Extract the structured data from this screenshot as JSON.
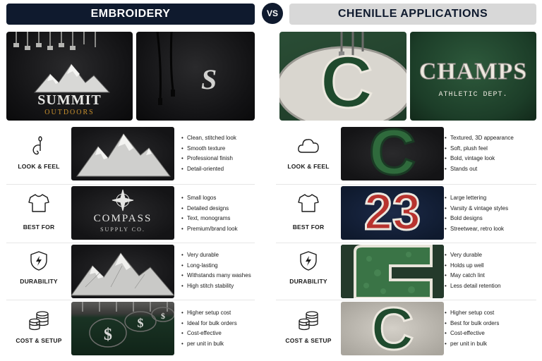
{
  "header": {
    "left_title": "EMBROIDERY",
    "vs": "VS",
    "right_title": "CHENILLE APPLICATIONS"
  },
  "photos": {
    "summit_main": "SUMMIT",
    "summit_sub": "OUTDOORS",
    "hoodie_letter": "S",
    "hoop_letter": "C",
    "champs_main": "CHAMPS",
    "champs_sub": "ATHLETIC DEPT."
  },
  "embroidery": {
    "rows": [
      {
        "label": "LOOK & FEEL",
        "icon": "needle-thread-icon",
        "bullets": [
          "Clean, stitched look",
          "Smooth texture",
          "Professional finish",
          "Detail-oriented"
        ]
      },
      {
        "label": "BEST FOR",
        "icon": "tshirt-icon",
        "compass_main": "COMPASS",
        "compass_sub": "SUPPLY CO.",
        "bullets": [
          "Small logos",
          "Detailed designs",
          "Text, monograms",
          "Premium/brand look"
        ]
      },
      {
        "label": "DURABILITY",
        "icon": "shield-bolt-icon",
        "bullets": [
          "Very durable",
          "Long-lasting",
          "Withstands many washes",
          "High stitch stability"
        ]
      },
      {
        "label": "COST & SETUP",
        "icon": "coin-stack-icon",
        "bullets": [
          "Higher setup cost",
          "Ideal for bulk orders",
          "Cost-effective",
          "per unit in bulk"
        ]
      }
    ]
  },
  "chenille": {
    "rows": [
      {
        "label": "LOOK & FEEL",
        "icon": "cloud-icon",
        "letter": "C",
        "bullets": [
          "Textured, 3D appearance",
          "Soft, plush feel",
          "Bold, vintage look",
          "Stands out"
        ]
      },
      {
        "label": "BEST FOR",
        "icon": "tshirt-icon",
        "number": "23",
        "bullets": [
          "Large lettering",
          "Varsity & vintage styles",
          "Bold designs",
          "Streetwear, retro look"
        ]
      },
      {
        "label": "DURABILITY",
        "icon": "shield-bolt-icon",
        "bullets": [
          "Very durable",
          "Holds up well",
          "May catch lint",
          "Less detail retention"
        ]
      },
      {
        "label": "COST & SETUP",
        "icon": "coin-stack-icon",
        "letter": "C",
        "bullets": [
          "Higher setup cost",
          "Best for bulk orders",
          "Cost-effective",
          "per unit in bulk"
        ]
      }
    ]
  },
  "colors": {
    "navy": "#0f1a2e",
    "chenille_green": "#1f4a2d",
    "chenille_red": "#b8332e",
    "felt_white": "#ece8df",
    "gold_thread": "#c8902e"
  }
}
